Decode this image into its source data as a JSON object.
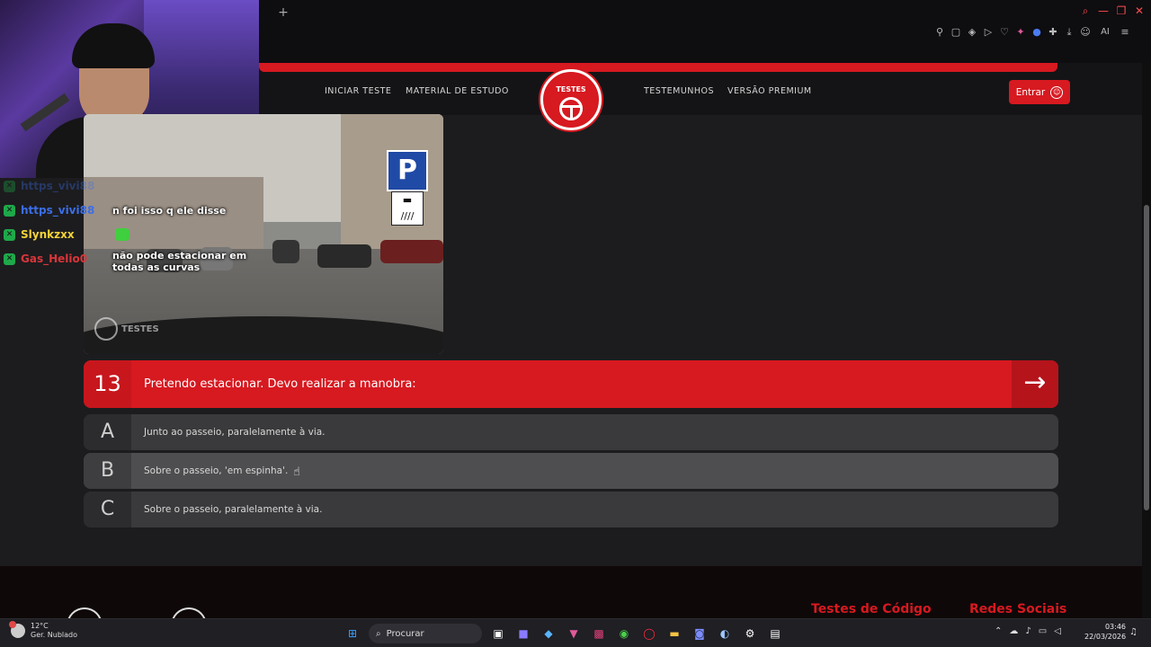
{
  "browser": {
    "new_tab": "+",
    "window_controls": [
      "⌕",
      "—",
      "❐",
      "✕"
    ],
    "toolbar_icons": [
      "pin-icon",
      "snapshot-icon",
      "shield-icon",
      "play-icon",
      "heart-icon",
      "spark-icon",
      "extension-icon",
      "puzzle-icon",
      "download-icon",
      "profile-icon",
      "aria-icon",
      "menu-icon"
    ],
    "ai_label": "AI"
  },
  "nav": {
    "links": [
      "INICIAR TESTE",
      "MATERIAL DE ESTUDO",
      "TESTEMUNHOS",
      "VERSÃO PREMIUM"
    ],
    "logo_text": "TESTES",
    "login_label": "Entrar",
    "accent": "#d71920"
  },
  "chat": {
    "lines": [
      {
        "user": "https_vivi88",
        "color": "#3b6ee8",
        "faded": true
      },
      {
        "user": "https_vivi88",
        "color": "#3b6ee8",
        "faded": false
      },
      {
        "user": "Slynkzxx",
        "color": "#f2d33a",
        "faded": false
      },
      {
        "user": "Gas_Helio0",
        "color": "#d9353a",
        "faded": false
      }
    ],
    "messages": [
      "n foi isso q ele disse",
      "não pode estacionar em todas as curvas"
    ]
  },
  "question": {
    "number": "13",
    "text": "Pretendo estacionar. Devo realizar a manobra:",
    "next_icon": "→",
    "image_sign": "P",
    "image_watermark": "TESTES"
  },
  "answers": [
    {
      "letter": "A",
      "text": "Junto ao passeio, paralelamente à via."
    },
    {
      "letter": "B",
      "text": "Sobre o passeio, 'em espinha'."
    },
    {
      "letter": "C",
      "text": "Sobre o passeio, paralelamente à via."
    }
  ],
  "footer": {
    "col1": "Testes de Código",
    "col2": "Redes Sociais"
  },
  "taskbar": {
    "weather_temp": "12°C",
    "weather_desc": "Ger. Nublado",
    "search_label": "Procurar",
    "time": "03:46",
    "date": "22/03/2026"
  }
}
